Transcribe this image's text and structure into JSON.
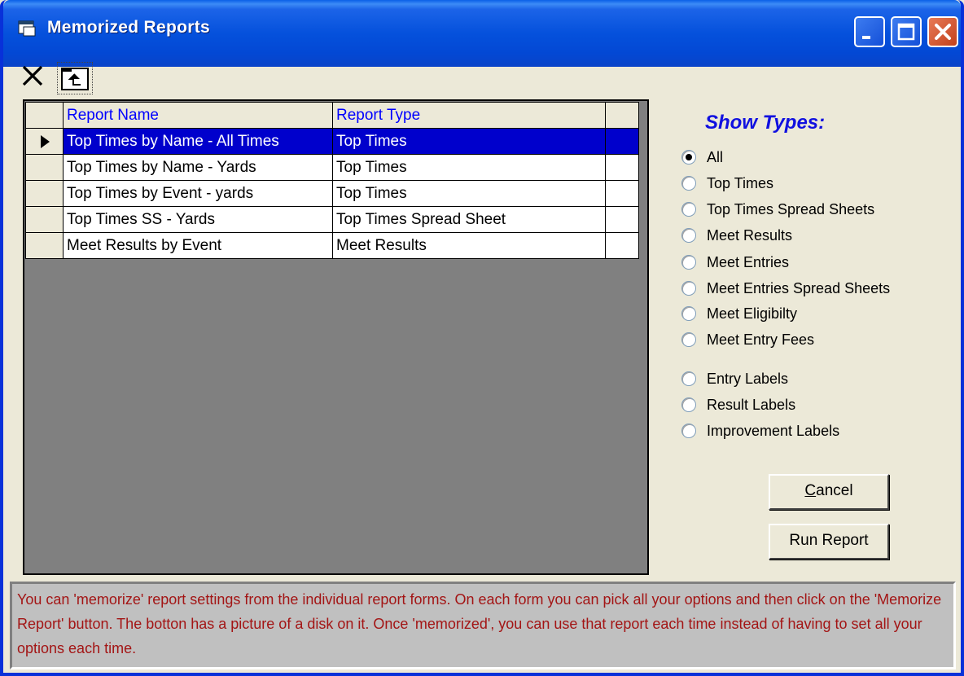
{
  "window": {
    "title": "Memorized Reports"
  },
  "toolbar": {
    "delete_icon": "x-icon",
    "folder_icon": "folder-up-icon"
  },
  "grid": {
    "columns": [
      "Report Name",
      "Report Type",
      ""
    ],
    "rows": [
      {
        "name": "Top Times by Name - All Times",
        "type": "Top Times",
        "selected": true
      },
      {
        "name": "Top Times by Name - Yards",
        "type": "Top Times",
        "selected": false
      },
      {
        "name": "Top Times by Event - yards",
        "type": "Top Times",
        "selected": false
      },
      {
        "name": "Top Times SS - Yards",
        "type": "Top Times Spread Sheet",
        "selected": false
      },
      {
        "name": "Meet Results by Event",
        "type": "Meet Results",
        "selected": false
      }
    ]
  },
  "show_types": {
    "title": "Show Types:",
    "options": [
      {
        "label": "All",
        "checked": true
      },
      {
        "label": "Top Times",
        "checked": false
      },
      {
        "label": "Top Times Spread Sheets",
        "checked": false
      },
      {
        "label": "Meet Results",
        "checked": false
      },
      {
        "label": "Meet Entries",
        "checked": false
      },
      {
        "label": "Meet Entries Spread Sheets",
        "checked": false
      },
      {
        "label": "Meet Eligibilty",
        "checked": false
      },
      {
        "label": "Meet Entry Fees",
        "checked": false
      },
      {
        "label": "Entry Labels",
        "checked": false
      },
      {
        "label": "Result Labels",
        "checked": false
      },
      {
        "label": "Improvement Labels",
        "checked": false
      }
    ]
  },
  "buttons": {
    "cancel": "Cancel",
    "run": "Run Report"
  },
  "info": {
    "text": "You can 'memorize' report settings from the individual report forms.  On each form you can pick all your options and then click on the 'Memorize Report' button. The botton has a picture of a disk on it.  Once 'memorized', you can use that report each time instead of having to set all your options each time."
  },
  "colors": {
    "titlebar": "#0551dc",
    "selection": "#0000cc",
    "header_text": "#0000ff",
    "show_types_title": "#1010e0",
    "info_text": "#a31515"
  }
}
